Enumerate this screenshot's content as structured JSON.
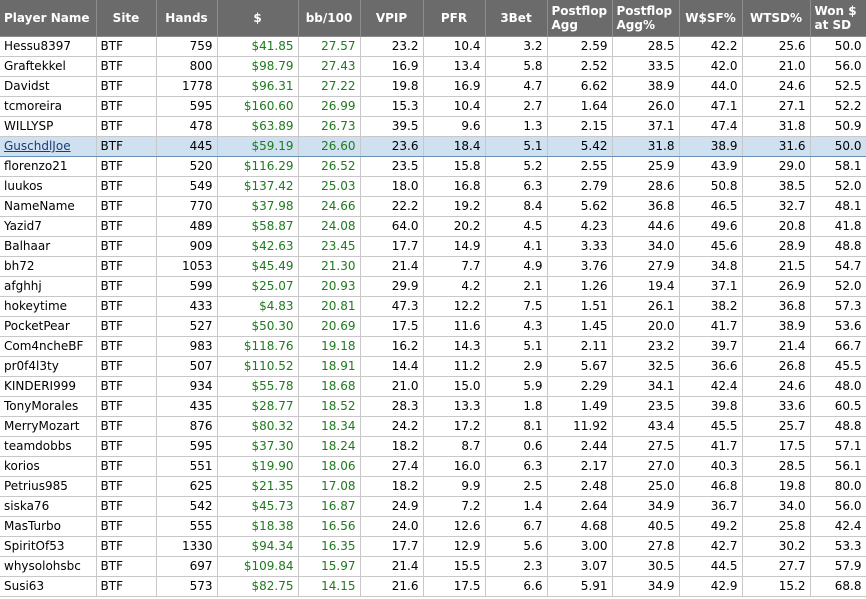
{
  "columns": [
    {
      "label": "Player Name",
      "align": "left"
    },
    {
      "label": "Site",
      "align": "center"
    },
    {
      "label": "Hands",
      "align": "center"
    },
    {
      "label": "$",
      "align": "center"
    },
    {
      "label": "bb/100",
      "align": "center"
    },
    {
      "label": "VPIP",
      "align": "center"
    },
    {
      "label": "PFR",
      "align": "center"
    },
    {
      "label": "3Bet",
      "align": "center"
    },
    {
      "label": "Postflop Agg",
      "align": "left"
    },
    {
      "label": "Postflop Agg%",
      "align": "left"
    },
    {
      "label": "W$SF%",
      "align": "center"
    },
    {
      "label": "WTSD%",
      "align": "center"
    },
    {
      "label": "Won $ at SD",
      "align": "left"
    }
  ],
  "selected_row": 5,
  "colors": {
    "header_bg": "#6b6b6b",
    "money": "#1e7a1e",
    "selected_bg": "#cfe0f0"
  },
  "rows": [
    [
      "Hessu8397",
      "BTF",
      "759",
      "$41.85",
      "27.57",
      "23.2",
      "10.4",
      "3.2",
      "2.59",
      "28.5",
      "42.2",
      "25.6",
      "50.0"
    ],
    [
      "Graftekkel",
      "BTF",
      "800",
      "$98.79",
      "27.43",
      "16.9",
      "13.4",
      "5.8",
      "2.52",
      "33.5",
      "42.0",
      "21.0",
      "56.0"
    ],
    [
      "Davidst",
      "BTF",
      "1778",
      "$96.31",
      "27.22",
      "19.8",
      "16.9",
      "4.7",
      "6.62",
      "38.9",
      "44.0",
      "24.6",
      "52.5"
    ],
    [
      "tcmoreira",
      "BTF",
      "595",
      "$160.60",
      "26.99",
      "15.3",
      "10.4",
      "2.7",
      "1.64",
      "26.0",
      "47.1",
      "27.1",
      "52.2"
    ],
    [
      "WILLYSP",
      "BTF",
      "478",
      "$63.89",
      "26.73",
      "39.5",
      "9.6",
      "1.3",
      "2.15",
      "37.1",
      "47.4",
      "31.8",
      "50.9"
    ],
    [
      "GuschdlJoe",
      "BTF",
      "445",
      "$59.19",
      "26.60",
      "23.6",
      "18.4",
      "5.1",
      "5.42",
      "31.8",
      "38.9",
      "31.6",
      "50.0"
    ],
    [
      "florenzo21",
      "BTF",
      "520",
      "$116.29",
      "26.52",
      "23.5",
      "15.8",
      "5.2",
      "2.55",
      "25.9",
      "43.9",
      "29.0",
      "58.1"
    ],
    [
      "luukos",
      "BTF",
      "549",
      "$137.42",
      "25.03",
      "18.0",
      "16.8",
      "6.3",
      "2.79",
      "28.6",
      "50.8",
      "38.5",
      "52.0"
    ],
    [
      "NameName",
      "BTF",
      "770",
      "$37.98",
      "24.66",
      "22.2",
      "19.2",
      "8.4",
      "5.62",
      "36.8",
      "46.5",
      "32.7",
      "48.1"
    ],
    [
      "Yazid7",
      "BTF",
      "489",
      "$58.87",
      "24.08",
      "64.0",
      "20.2",
      "4.5",
      "4.23",
      "44.6",
      "49.6",
      "20.8",
      "41.8"
    ],
    [
      "Balhaar",
      "BTF",
      "909",
      "$42.63",
      "23.45",
      "17.7",
      "14.9",
      "4.1",
      "3.33",
      "34.0",
      "45.6",
      "28.9",
      "48.8"
    ],
    [
      "bh72",
      "BTF",
      "1053",
      "$45.49",
      "21.30",
      "21.4",
      "7.7",
      "4.9",
      "3.76",
      "27.9",
      "34.8",
      "21.5",
      "54.7"
    ],
    [
      "afghhj",
      "BTF",
      "599",
      "$25.07",
      "20.93",
      "29.9",
      "4.2",
      "2.1",
      "1.26",
      "19.4",
      "37.1",
      "26.9",
      "52.0"
    ],
    [
      "hokeytime",
      "BTF",
      "433",
      "$4.83",
      "20.81",
      "47.3",
      "12.2",
      "7.5",
      "1.51",
      "26.1",
      "38.2",
      "36.8",
      "57.3"
    ],
    [
      "PocketPear",
      "BTF",
      "527",
      "$50.30",
      "20.69",
      "17.5",
      "11.6",
      "4.3",
      "1.45",
      "20.0",
      "41.7",
      "38.9",
      "53.6"
    ],
    [
      "Com4ncheBF",
      "BTF",
      "983",
      "$118.76",
      "19.18",
      "16.2",
      "14.3",
      "5.1",
      "2.11",
      "23.2",
      "39.7",
      "21.4",
      "66.7"
    ],
    [
      "pr0f4l3ty",
      "BTF",
      "507",
      "$110.52",
      "18.91",
      "14.4",
      "11.2",
      "2.9",
      "5.67",
      "32.5",
      "36.6",
      "26.8",
      "45.5"
    ],
    [
      "KINDERI999",
      "BTF",
      "934",
      "$55.78",
      "18.68",
      "21.0",
      "15.0",
      "5.9",
      "2.29",
      "34.1",
      "42.4",
      "24.6",
      "48.0"
    ],
    [
      "TonyMorales",
      "BTF",
      "435",
      "$28.77",
      "18.52",
      "28.3",
      "13.3",
      "1.8",
      "1.49",
      "23.5",
      "39.8",
      "33.6",
      "60.5"
    ],
    [
      "MerryMozart",
      "BTF",
      "876",
      "$80.32",
      "18.34",
      "24.2",
      "17.2",
      "8.1",
      "11.92",
      "43.4",
      "45.5",
      "25.7",
      "48.8"
    ],
    [
      "teamdobbs",
      "BTF",
      "595",
      "$37.30",
      "18.24",
      "18.2",
      "8.7",
      "0.6",
      "2.44",
      "27.5",
      "41.7",
      "17.5",
      "57.1"
    ],
    [
      "korios",
      "BTF",
      "551",
      "$19.90",
      "18.06",
      "27.4",
      "16.0",
      "6.3",
      "2.17",
      "27.0",
      "40.3",
      "28.5",
      "56.1"
    ],
    [
      "Petrius985",
      "BTF",
      "625",
      "$21.35",
      "17.08",
      "18.2",
      "9.9",
      "2.5",
      "2.48",
      "25.0",
      "46.8",
      "19.8",
      "80.0"
    ],
    [
      "siska76",
      "BTF",
      "542",
      "$45.73",
      "16.87",
      "24.9",
      "7.2",
      "1.4",
      "2.64",
      "34.9",
      "36.7",
      "34.0",
      "56.0"
    ],
    [
      "MasTurbo",
      "BTF",
      "555",
      "$18.38",
      "16.56",
      "24.0",
      "12.6",
      "6.7",
      "4.68",
      "40.5",
      "49.2",
      "25.8",
      "42.4"
    ],
    [
      "SpiritOf53",
      "BTF",
      "1330",
      "$94.34",
      "16.35",
      "17.7",
      "12.9",
      "5.6",
      "3.00",
      "27.8",
      "42.7",
      "30.2",
      "53.3"
    ],
    [
      "whysolohsbc",
      "BTF",
      "697",
      "$109.84",
      "15.97",
      "21.4",
      "15.5",
      "2.3",
      "3.07",
      "30.5",
      "44.5",
      "27.7",
      "57.9"
    ],
    [
      "Susi63",
      "BTF",
      "573",
      "$82.75",
      "14.15",
      "21.6",
      "17.5",
      "6.6",
      "5.91",
      "34.9",
      "42.9",
      "15.2",
      "68.8"
    ]
  ]
}
